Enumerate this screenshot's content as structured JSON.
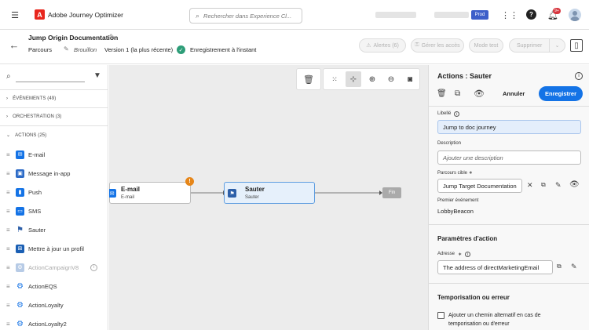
{
  "app": {
    "title": "Adobe Journey Optimizer"
  },
  "search": {
    "placeholder": "Rechercher dans Experience Cl..."
  },
  "topbar": {
    "badge_count": "9+",
    "org_pill": "Prod"
  },
  "journey": {
    "title": "Jump Origin Documentation",
    "breadcrumb": "Parcours",
    "status": "Brouillon",
    "version": "Version 1 (la plus récente)",
    "save_status": "Enregistrement à l'instant"
  },
  "header_buttons": {
    "alerts": "Alertes (6)",
    "access": "Gérer les accès",
    "test": "Mode test",
    "delete": "Supprimer"
  },
  "palette": {
    "search_value": "",
    "sections": {
      "events": "ÉVÉNEMENTS (49)",
      "orchestration": "ORCHESTRATION (3)",
      "actions": "ACTIONS (25)"
    },
    "items": [
      {
        "label": "E-mail",
        "color": "#1473e6"
      },
      {
        "label": "Message in-app",
        "color": "#2d6bc7"
      },
      {
        "label": "Push",
        "color": "#1473e6"
      },
      {
        "label": "SMS",
        "color": "#1473e6"
      },
      {
        "label": "Sauter",
        "color": "#2d5fa8"
      },
      {
        "label": "Mettre à jour un profil",
        "color": "#1a5fb4"
      },
      {
        "label": "ActionCampaignV8",
        "color": "#9bb8df"
      },
      {
        "label": "ActionEQS",
        "color": "#1473e6"
      },
      {
        "label": "ActionLoyalty",
        "color": "#1473e6"
      },
      {
        "label": "ActionLoyalty2",
        "color": "#1473e6"
      }
    ]
  },
  "canvas": {
    "nodes": [
      {
        "title": "E-mail",
        "subtitle": "E-mail"
      },
      {
        "title": "Sauter",
        "subtitle": "Sauter"
      }
    ],
    "end_label": "Fin",
    "warning": "!"
  },
  "panel": {
    "title": "Actions : Sauter",
    "cancel": "Annuler",
    "save": "Enregistrer",
    "libelle_label": "Libellé",
    "libelle_value": "Jump to doc journey",
    "description_label": "Description",
    "description_placeholder": "Ajouter une description",
    "target_label": "Parcours cible",
    "target_value": "Jump Target Documentation",
    "first_event_label": "Premier événement",
    "first_event_value": "LobbyBeacon",
    "params_title": "Paramètres d'action",
    "address_label": "Adresse",
    "address_value": "The address of directMarketingEmail",
    "timeout_title": "Temporisation ou erreur",
    "timeout_checkbox": "Ajouter un chemin alternatif en cas de temporisation ou d'erreur"
  }
}
